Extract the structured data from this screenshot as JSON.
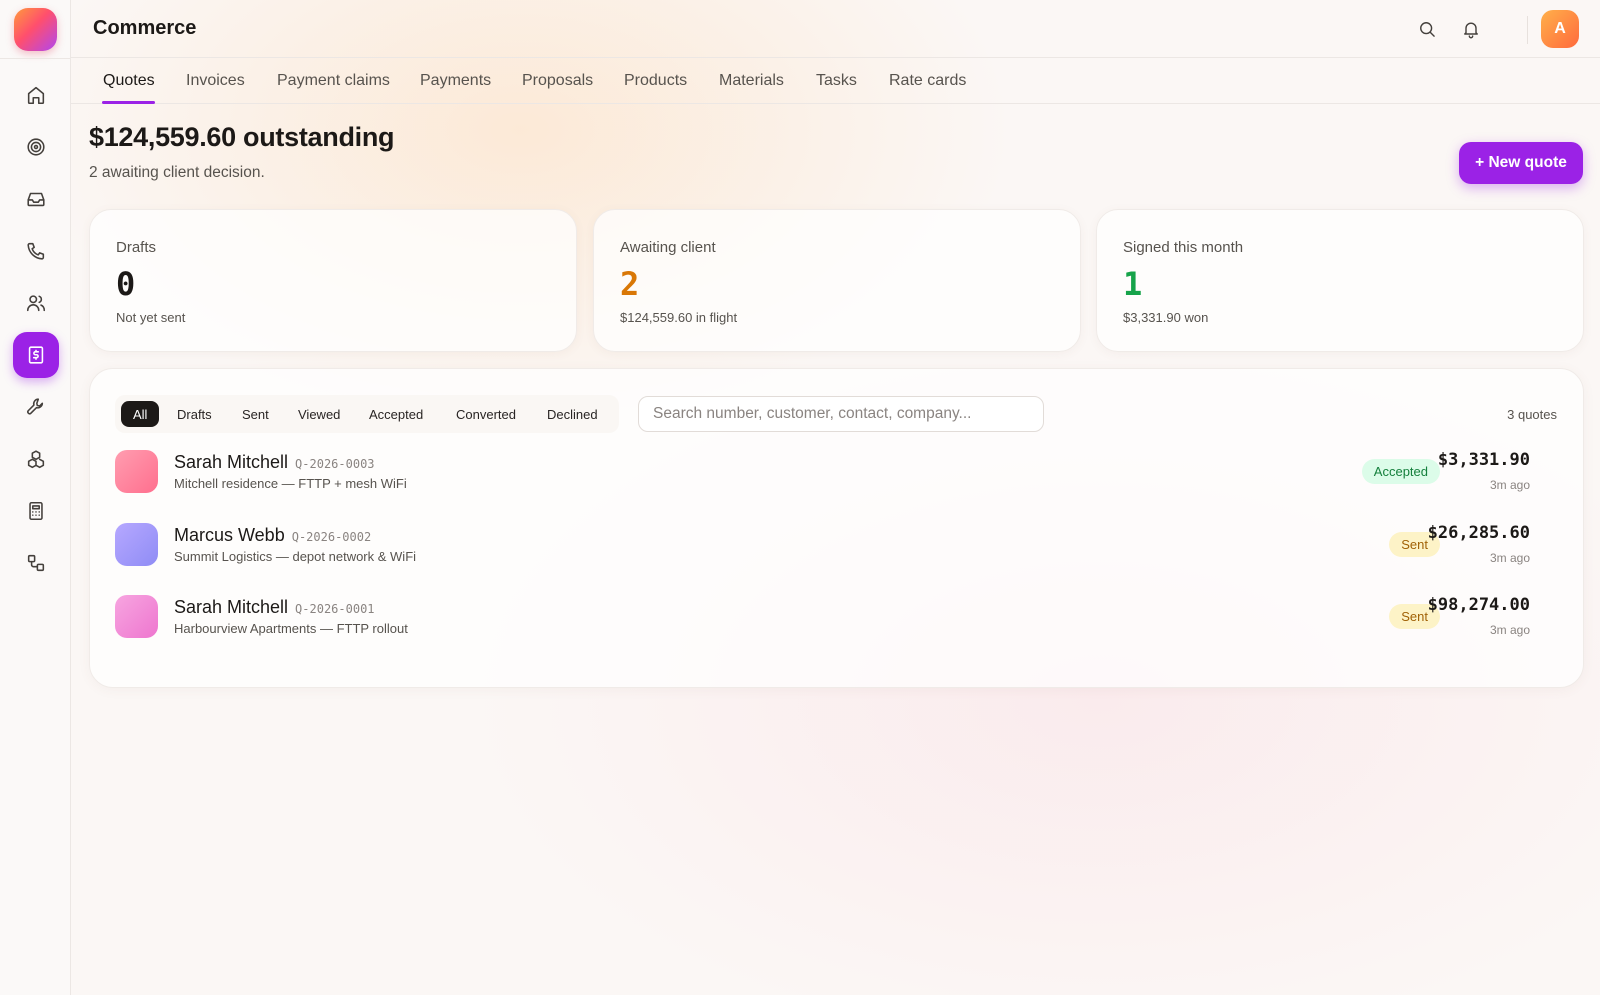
{
  "app": {
    "title": "Commerce",
    "avatar_initial": "A"
  },
  "sidebar": {
    "items": [
      {
        "icon": "home-icon"
      },
      {
        "icon": "target-icon"
      },
      {
        "icon": "inbox-icon"
      },
      {
        "icon": "phone-icon"
      },
      {
        "icon": "users-icon"
      },
      {
        "icon": "dollar-document-icon",
        "active": true
      },
      {
        "icon": "wrench-icon"
      },
      {
        "icon": "boxes-icon"
      },
      {
        "icon": "calculator-icon"
      },
      {
        "icon": "workflow-icon"
      }
    ]
  },
  "header": {
    "icons": [
      "search-icon",
      "bell-icon"
    ]
  },
  "tabs": [
    {
      "label": "Quotes",
      "active": true
    },
    {
      "label": "Invoices"
    },
    {
      "label": "Payment claims"
    },
    {
      "label": "Payments"
    },
    {
      "label": "Proposals"
    },
    {
      "label": "Products"
    },
    {
      "label": "Materials"
    },
    {
      "label": "Tasks"
    },
    {
      "label": "Rate cards"
    }
  ],
  "summary": {
    "headline": "$124,559.60 outstanding",
    "subline": "2 awaiting client decision.",
    "new_quote_label": "+ New quote"
  },
  "stats": [
    {
      "label": "Drafts",
      "value": "0",
      "note": "Not yet sent",
      "color": "#1c1917"
    },
    {
      "label": "Awaiting client",
      "value": "2",
      "note": "$124,559.60 in flight",
      "color": "#d97706"
    },
    {
      "label": "Signed this month",
      "value": "1",
      "note": "$3,331.90 won",
      "color": "#16a34a"
    }
  ],
  "filters": {
    "options": [
      "All",
      "Drafts",
      "Sent",
      "Viewed",
      "Accepted",
      "Converted",
      "Declined"
    ],
    "selected": "All",
    "search_placeholder": "Search number, customer, contact, company...",
    "count": "3 quotes"
  },
  "quotes": [
    {
      "name": "Sarah Mitchell",
      "number": "Q-2026-0003",
      "description": "Mitchell residence — FTTP + mesh WiFi",
      "status": "Accepted",
      "amount": "$3,331.90",
      "ago": "3m ago"
    },
    {
      "name": "Marcus Webb",
      "number": "Q-2026-0002",
      "description": "Summit Logistics — depot network & WiFi",
      "status": "Sent",
      "amount": "$26,285.60",
      "ago": "3m ago"
    },
    {
      "name": "Sarah Mitchell",
      "number": "Q-2026-0001",
      "description": "Harbourview Apartments — FTTP rollout",
      "status": "Sent",
      "amount": "$98,274.00",
      "ago": "3m ago"
    }
  ],
  "colors": {
    "accent": "#9b22e6",
    "accepted": "#15803d",
    "sent": "#a16207"
  }
}
